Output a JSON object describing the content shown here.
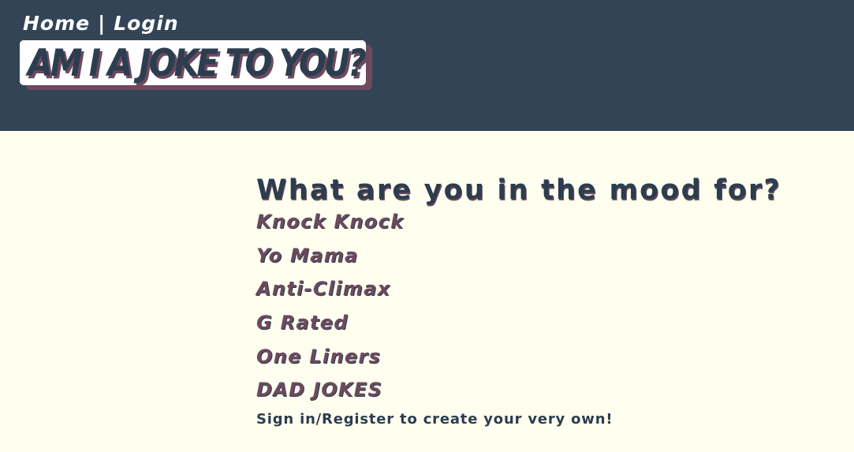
{
  "nav": {
    "home_label": "Home",
    "separator": "|",
    "login_label": "Login"
  },
  "brand": {
    "title": "AM I A JOKE TO YOU?"
  },
  "main": {
    "heading": "What are you in the mood for?",
    "categories": [
      {
        "label": "Knock Knock"
      },
      {
        "label": "Yo Mama"
      },
      {
        "label": "Anti-Climax"
      },
      {
        "label": "G Rated"
      },
      {
        "label": "One Liners"
      },
      {
        "label": "DAD JOKES"
      }
    ],
    "signin_note": "Sign in/Register to create your very own!"
  },
  "colors": {
    "header_bg": "#324456",
    "page_bg": "#fffff0",
    "heading_text": "#2c3d4f",
    "accent": "#6d4a5e",
    "logo_bg": "#ffffff"
  }
}
